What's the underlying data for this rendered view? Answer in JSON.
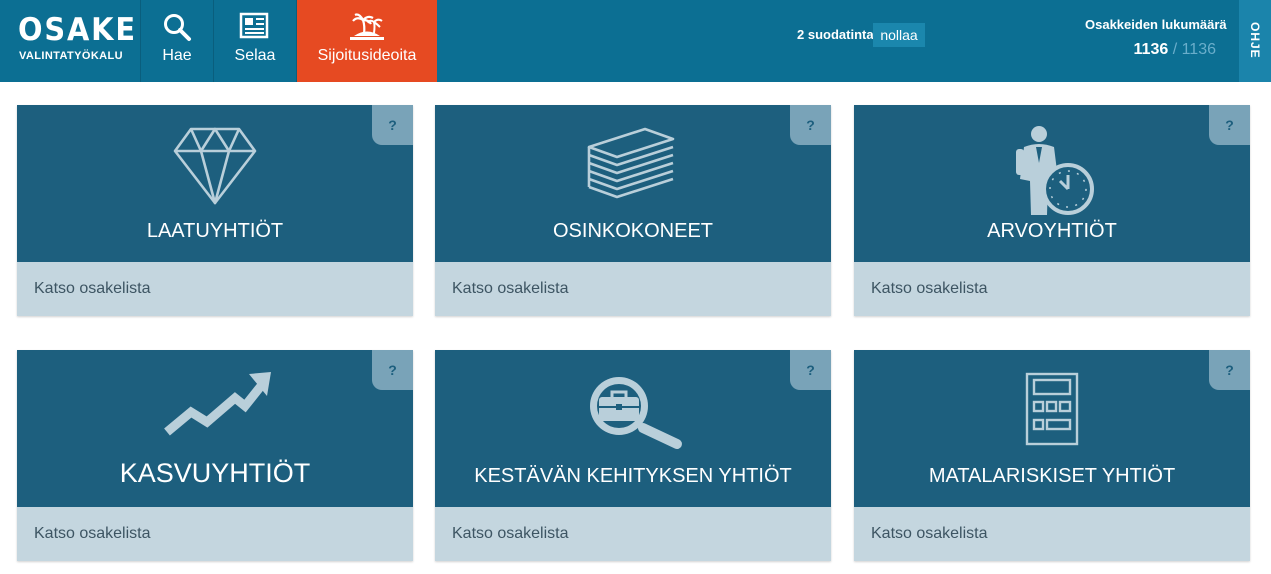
{
  "logo": {
    "title": "OSAKE",
    "subtitle": "VALINTATYÖKALU"
  },
  "nav": [
    {
      "label": "Hae",
      "icon": "search-icon"
    },
    {
      "label": "Selaa",
      "icon": "newspaper-icon"
    },
    {
      "label": "Sijoitusideoita",
      "icon": "island-icon",
      "active": true
    }
  ],
  "filters": {
    "text": "2 suodatinta",
    "reset_label": "nollaa"
  },
  "count": {
    "label": "Osakkeiden lukumäärä",
    "current": "1136",
    "separator": " / ",
    "total": "1136"
  },
  "help_tab": {
    "label": "OHJE"
  },
  "cards": [
    {
      "title": "LAATUYHTIÖT",
      "link": "Katso osakelista",
      "help": "?",
      "icon": "diamond-icon"
    },
    {
      "title": "OSINKOKONEET",
      "link": "Katso osakelista",
      "help": "?",
      "icon": "paper-stack-icon"
    },
    {
      "title": "ARVOYHTIÖT",
      "link": "Katso osakelista",
      "help": "?",
      "icon": "businessman-clock-icon"
    },
    {
      "title": "KASVUYHTIÖT",
      "link": "Katso osakelista",
      "help": "?",
      "icon": "trend-arrow-icon"
    },
    {
      "title": "KESTÄVÄN KEHITYKSEN YHTIÖT",
      "link": "Katso osakelista",
      "help": "?",
      "icon": "magnifier-briefcase-icon"
    },
    {
      "title": "MATALARISKISET YHTIÖT",
      "link": "Katso osakelista",
      "help": "?",
      "icon": "calculator-icon"
    }
  ],
  "colors": {
    "topbar": "#0c6f93",
    "active_nav": "#e64a22",
    "card_top": "#1d5f7e",
    "card_bottom": "#c4d6df",
    "help_badge": "#79a3b8"
  }
}
